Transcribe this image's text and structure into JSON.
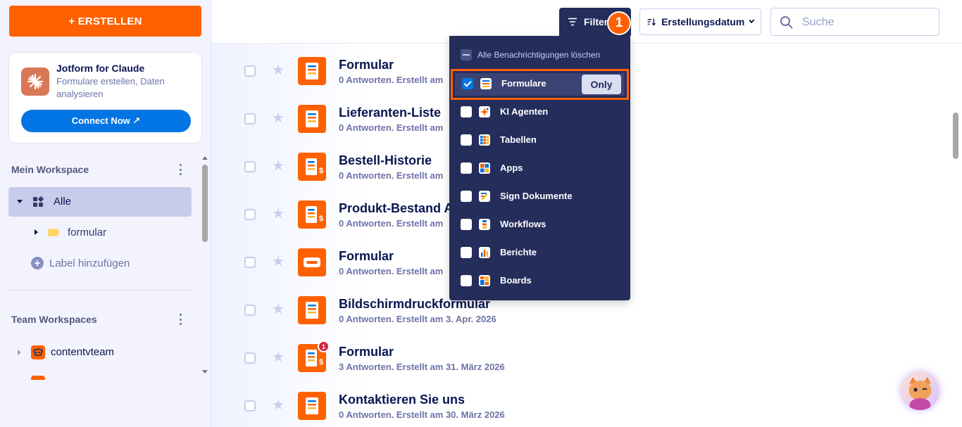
{
  "sidebar": {
    "create_label": "+ ERSTELLEN",
    "promo": {
      "title": "Jotform for Claude",
      "subtitle": "Formulare erstellen, Daten analysieren",
      "connect_label": "Connect Now ↗"
    },
    "my_workspace": {
      "heading": "Mein Workspace",
      "all_label": "Alle",
      "folder_label": "formular",
      "add_label": "Label hinzufügen"
    },
    "team_workspaces": {
      "heading": "Team Workspaces",
      "items": [
        {
          "label": "contentvteam"
        }
      ]
    }
  },
  "topbar": {
    "filter_label": "Filter",
    "step_badge": "1",
    "sort_label": "Erstellungsdatum",
    "search_placeholder": "Suche"
  },
  "filter_dropdown": {
    "clear_label": "Alle Benachrichtigungen löschen",
    "only_label": "Only",
    "items": [
      {
        "label": "Formulare",
        "checked": true,
        "icon": "form-icon"
      },
      {
        "label": "KI Agenten",
        "checked": false,
        "icon": "ai-agent-icon"
      },
      {
        "label": "Tabellen",
        "checked": false,
        "icon": "tables-icon"
      },
      {
        "label": "Apps",
        "checked": false,
        "icon": "apps-icon"
      },
      {
        "label": "Sign Dokumente",
        "checked": false,
        "icon": "sign-icon"
      },
      {
        "label": "Workflows",
        "checked": false,
        "icon": "workflow-icon"
      },
      {
        "label": "Berichte",
        "checked": false,
        "icon": "reports-icon"
      },
      {
        "label": "Boards",
        "checked": false,
        "icon": "boards-icon"
      }
    ]
  },
  "forms": [
    {
      "title": "Formular",
      "meta": "0 Antworten. Erstellt am",
      "icon": "form-icon"
    },
    {
      "title": "Lieferanten-Liste",
      "meta": "0 Antworten. Erstellt am",
      "icon": "form-icon"
    },
    {
      "title": "Bestell-Historie",
      "meta": "0 Antworten. Erstellt am",
      "icon": "payment-form-icon"
    },
    {
      "title": "Produkt-Bestand A",
      "meta": "0 Antworten. Erstellt am",
      "icon": "payment-form-icon"
    },
    {
      "title": "Formular",
      "meta": "0 Antworten. Erstellt am",
      "icon": "card-form-icon"
    },
    {
      "title": "Bildschirmdruckformular",
      "meta": "0 Antworten. Erstellt am 3. Apr. 2026",
      "icon": "form-icon"
    },
    {
      "title": "Formular",
      "meta": "3 Antworten. Erstellt am 31. März 2026",
      "icon": "payment-form-icon",
      "badge": "1"
    },
    {
      "title": "Kontaktieren Sie uns",
      "meta": "0 Antworten. Erstellt am 30. März 2026",
      "icon": "form-icon"
    }
  ],
  "colors": {
    "accent": "#ff6100",
    "navy": "#252d5b",
    "link_blue": "#0075e3"
  }
}
